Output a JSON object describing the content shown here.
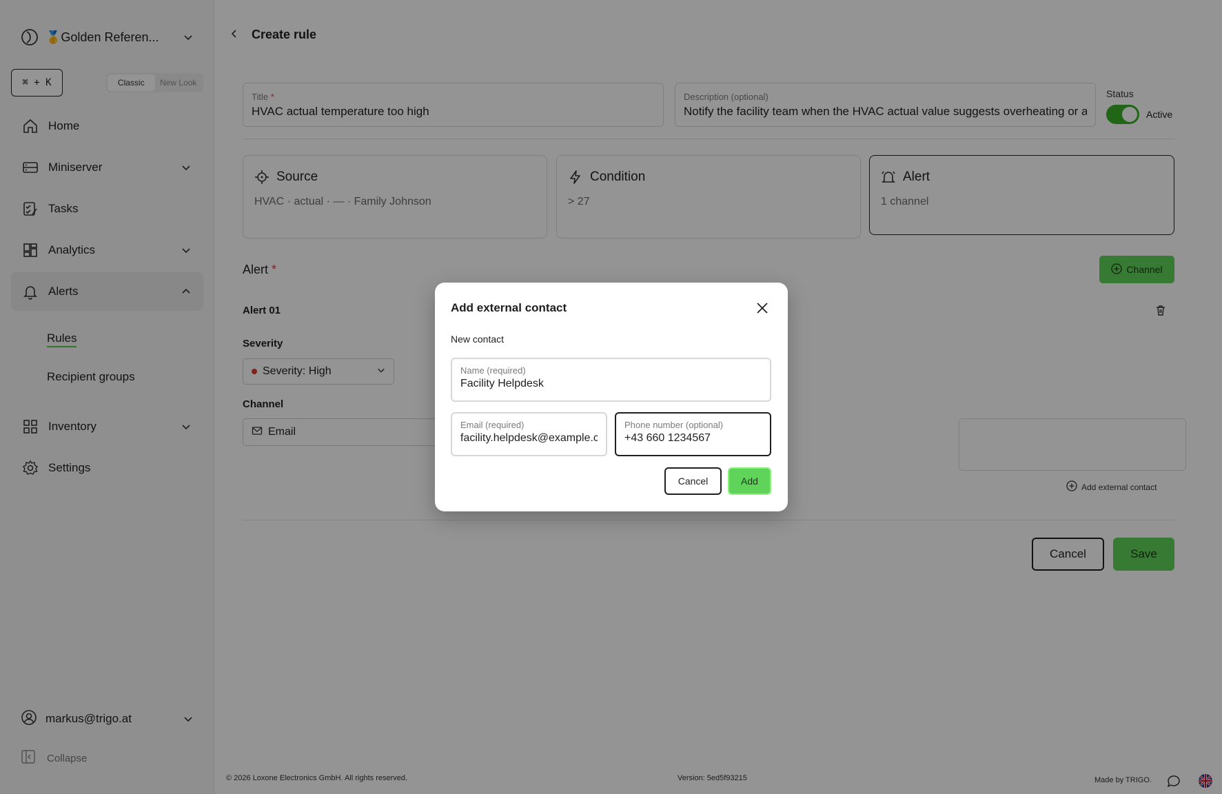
{
  "sidebar": {
    "workspace": "🥇Golden Referen...",
    "shortcut": "⌘ + K",
    "look_options": [
      "Classic",
      "New Look"
    ],
    "nav": {
      "home": "Home",
      "miniserver": "Miniserver",
      "tasks": "Tasks",
      "analytics": "Analytics",
      "alerts": "Alerts",
      "inventory": "Inventory",
      "settings": "Settings"
    },
    "alerts_sub": [
      "Rules",
      "Recipient groups"
    ],
    "user": "markus@trigo.at",
    "collapse": "Collapse"
  },
  "page": {
    "title": "Create rule",
    "title_field": {
      "label": "Title",
      "required_mark": "*",
      "value": "HVAC actual temperature too high"
    },
    "description_field": {
      "label": "Description (optional)",
      "value": "Notify the facility team when the HVAC actual value suggests overheating or a malfunction"
    },
    "status": {
      "label": "Status",
      "value": "Active"
    },
    "steps": [
      {
        "title": "Source",
        "body": "HVAC · actual · — · Family Johnson",
        "icon": "crosshair-icon"
      },
      {
        "title": "Condition",
        "body": "> 27",
        "icon": "lightning-icon"
      },
      {
        "title": "Alert",
        "body": "1 channel",
        "icon": "bell-icon"
      }
    ],
    "alert_section": {
      "label": "Alert",
      "required_mark": "*",
      "channel_button": "Channel"
    },
    "alert_item": {
      "name": "Alert 01",
      "severity_label": "Severity",
      "severity_value": "Severity: High",
      "channel_label": "Channel",
      "channel_value": "Email",
      "add_external_link": "Add external contact"
    },
    "actions": {
      "cancel": "Cancel",
      "save": "Save"
    }
  },
  "footer": {
    "copyright": "© 2026 Loxone Electronics GmbH. All rights reserved.",
    "version": "Version: 5ed5f93215",
    "made_by": "Made by TRIGO."
  },
  "modal": {
    "title": "Add external contact",
    "subtitle": "New contact",
    "name": {
      "label": "Name (required)",
      "value": "Facility Helpdesk"
    },
    "email": {
      "label": "Email (required)",
      "value": "facility.helpdesk@example.com"
    },
    "phone": {
      "label": "Phone number (optional)",
      "value": "+43 660 1234567"
    },
    "cancel": "Cancel",
    "add": "Add"
  },
  "colors": {
    "accent": "#5fd35a",
    "toggle_on": "#3ab028",
    "required": "#e03c31",
    "severity_dot": "#e03c31"
  }
}
